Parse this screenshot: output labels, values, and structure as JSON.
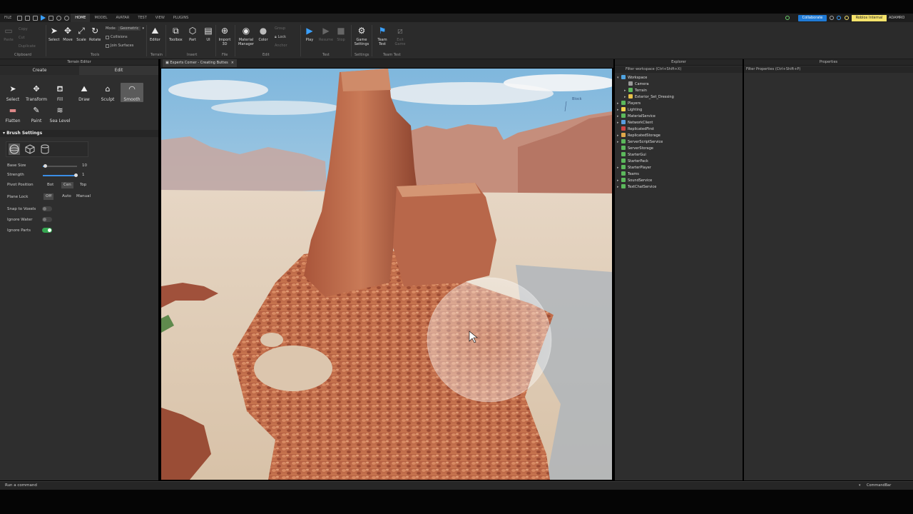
{
  "menu": {
    "file": "FILE",
    "tabs": [
      "HOME",
      "MODEL",
      "AVATAR",
      "TEST",
      "VIEW",
      "PLUGINS"
    ],
    "active_tab": "HOME",
    "collaborate": "Collaborate",
    "badge": "Roblox Internal",
    "user": "ADAMRO"
  },
  "ribbon": {
    "clipboard": {
      "paste": "Paste",
      "copy": "Copy",
      "cut": "Cut",
      "duplicate": "Duplicate",
      "label": "Clipboard"
    },
    "tools": {
      "select": "Select",
      "move": "Move",
      "scale": "Scale",
      "rotate": "Rotate",
      "mode_label": "Mode:",
      "mode_value": "Geometric",
      "collisions": "Collisions",
      "join_surfaces": "Join Surfaces",
      "label": "Tools"
    },
    "terrain": {
      "editor": "Editor",
      "label": "Terrain"
    },
    "insert": {
      "toolbox": "Toolbox",
      "part": "Part",
      "ui": "UI",
      "label": "Insert"
    },
    "file": {
      "import3d": "Import 3D",
      "label": "File"
    },
    "edit": {
      "material": "Material Manager",
      "color": "Color",
      "group": "Group",
      "lock": "Lock",
      "anchor": "Anchor",
      "label": "Edit"
    },
    "test": {
      "play": "Play",
      "resume": "Resume",
      "stop": "Stop",
      "label": "Test"
    },
    "settings": {
      "game_settings": "Game Settings",
      "label": "Settings"
    },
    "team_test": {
      "team_test": "Team Test",
      "exit_game": "Exit Game",
      "label": "Team Test"
    }
  },
  "terrain_editor": {
    "title": "Terrain Editor",
    "tabs": [
      "Create",
      "Edit"
    ],
    "active_tab": "Edit",
    "tools": [
      {
        "label": "Select",
        "icon": "cursor-icon"
      },
      {
        "label": "Transform",
        "icon": "transform-icon"
      },
      {
        "label": "Fill",
        "icon": "fill-icon"
      },
      {
        "label": "Draw",
        "icon": "draw-icon"
      },
      {
        "label": "Sculpt",
        "icon": "sculpt-icon"
      },
      {
        "label": "Smooth",
        "icon": "smooth-icon"
      },
      {
        "label": "Flatten",
        "icon": "flatten-icon"
      },
      {
        "label": "Paint",
        "icon": "paint-icon"
      },
      {
        "label": "Sea Level",
        "icon": "sea-level-icon"
      }
    ],
    "active_tool": "Smooth",
    "brush_settings": {
      "header": "Brush Settings",
      "base_size_label": "Base Size",
      "base_size_value": "10",
      "base_size_fraction": 0.07,
      "strength_label": "Strength",
      "strength_value": "1",
      "strength_fraction": 1.0,
      "pivot_label": "Pivot Position",
      "pivot_options": [
        "Bot",
        "Cen",
        "Top"
      ],
      "pivot_selected": "Cen",
      "plane_lock_label": "Plane Lock",
      "plane_lock_options": [
        "Off",
        "Auto",
        "Manual"
      ],
      "plane_lock_selected": "Off",
      "snap_label": "Snap to Voxels",
      "snap_on": false,
      "ignore_water_label": "Ignore Water",
      "ignore_water_on": false,
      "ignore_parts_label": "Ignore Parts",
      "ignore_parts_on": true
    }
  },
  "document": {
    "tab_title": "Experts Corner - Creating Buttes"
  },
  "explorer": {
    "title": "Explorer",
    "filter_placeholder": "Filter workspace (Ctrl+Shift+X)",
    "items": [
      {
        "label": "Workspace",
        "depth": 0,
        "expanded": true,
        "color": "#4fa3e0"
      },
      {
        "label": "Camera",
        "depth": 1,
        "expanded": null,
        "color": "#9a9a9a"
      },
      {
        "label": "Terrain",
        "depth": 1,
        "expanded": false,
        "color": "#5cb85c"
      },
      {
        "label": "Exterior_Set_Dressing",
        "depth": 1,
        "expanded": false,
        "color": "#e8c04a"
      },
      {
        "label": "Players",
        "depth": 0,
        "expanded": false,
        "color": "#5cb85c"
      },
      {
        "label": "Lighting",
        "depth": 0,
        "expanded": false,
        "color": "#f2d04b"
      },
      {
        "label": "MaterialService",
        "depth": 0,
        "expanded": false,
        "color": "#5cb85c"
      },
      {
        "label": "NetworkClient",
        "depth": 0,
        "expanded": false,
        "color": "#5a9ee0"
      },
      {
        "label": "ReplicatedFirst",
        "depth": 0,
        "expanded": null,
        "color": "#c44"
      },
      {
        "label": "ReplicatedStorage",
        "depth": 0,
        "expanded": false,
        "color": "#e0a84a"
      },
      {
        "label": "ServerScriptService",
        "depth": 0,
        "expanded": false,
        "color": "#5cb85c"
      },
      {
        "label": "ServerStorage",
        "depth": 0,
        "expanded": null,
        "color": "#5cb85c"
      },
      {
        "label": "StarterGui",
        "depth": 0,
        "expanded": null,
        "color": "#5cb85c"
      },
      {
        "label": "StarterPack",
        "depth": 0,
        "expanded": null,
        "color": "#5cb85c"
      },
      {
        "label": "StarterPlayer",
        "depth": 0,
        "expanded": false,
        "color": "#5cb85c"
      },
      {
        "label": "Teams",
        "depth": 0,
        "expanded": null,
        "color": "#5cb85c"
      },
      {
        "label": "SoundService",
        "depth": 0,
        "expanded": false,
        "color": "#5cb85c"
      },
      {
        "label": "TextChatService",
        "depth": 0,
        "expanded": false,
        "color": "#5cb85c"
      }
    ]
  },
  "properties": {
    "title": "Properties",
    "filter_placeholder": "Filter Properties (Ctrl+Shift+P)"
  },
  "viewport": {
    "label_text": "Block"
  },
  "command_bar": {
    "placeholder": "Run a command",
    "label": "CommandBar"
  }
}
